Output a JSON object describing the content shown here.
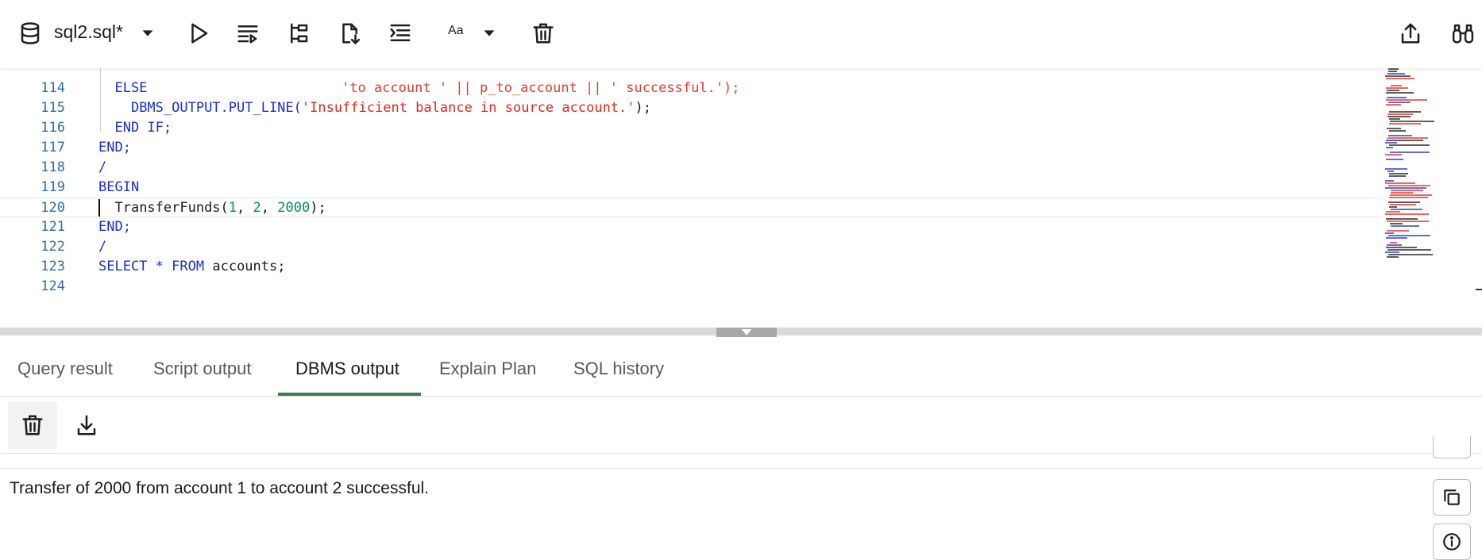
{
  "toolbar": {
    "file_name": "sql2.sql*",
    "font_label": "Aa",
    "icons": [
      "database-icon",
      "chevron-down-icon",
      "run-icon",
      "run-script-icon",
      "explain-plan-icon",
      "save-file-icon",
      "format-icon",
      "font-size-icon",
      "delete-icon",
      "share-icon",
      "binoculars-icon"
    ]
  },
  "editor": {
    "partial_top_line": "'to account ' || p_to_account || ' successful.');",
    "lines": [
      {
        "n": "114",
        "indent": "  ",
        "parts": [
          {
            "t": "ELSE",
            "c": "kw"
          }
        ]
      },
      {
        "n": "115",
        "indent": "    ",
        "parts": [
          {
            "t": "DBMS_OUTPUT.PUT_LINE(",
            "c": "kw"
          },
          {
            "t": "'Insufficient balance in source account.'",
            "c": "str"
          },
          {
            "t": ");",
            "c": "plain"
          }
        ]
      },
      {
        "n": "116",
        "indent": "  ",
        "parts": [
          {
            "t": "END IF;",
            "c": "kw"
          }
        ]
      },
      {
        "n": "117",
        "indent": "",
        "parts": [
          {
            "t": "END;",
            "c": "kw"
          }
        ]
      },
      {
        "n": "118",
        "indent": "",
        "parts": [
          {
            "t": "/",
            "c": "kw"
          }
        ]
      },
      {
        "n": "119",
        "indent": "",
        "parts": [
          {
            "t": "BEGIN",
            "c": "kw"
          }
        ]
      },
      {
        "n": "120",
        "indent": "  ",
        "parts": [
          {
            "t": "TransferFunds(",
            "c": "plain"
          },
          {
            "t": "1",
            "c": "num"
          },
          {
            "t": ", ",
            "c": "plain"
          },
          {
            "t": "2",
            "c": "num"
          },
          {
            "t": ", ",
            "c": "plain"
          },
          {
            "t": "2000",
            "c": "num"
          },
          {
            "t": ");",
            "c": "plain"
          }
        ]
      },
      {
        "n": "121",
        "indent": "",
        "parts": [
          {
            "t": "END;",
            "c": "kw"
          }
        ]
      },
      {
        "n": "122",
        "indent": "",
        "parts": [
          {
            "t": "/",
            "c": "kw"
          }
        ]
      },
      {
        "n": "123",
        "indent": "",
        "parts": [
          {
            "t": "SELECT",
            "c": "kw"
          },
          {
            "t": " ",
            "c": "plain"
          },
          {
            "t": "*",
            "c": "kw"
          },
          {
            "t": " ",
            "c": "plain"
          },
          {
            "t": "FROM",
            "c": "kw"
          },
          {
            "t": " accounts;",
            "c": "plain"
          }
        ]
      },
      {
        "n": "124",
        "indent": "",
        "parts": []
      }
    ]
  },
  "tabs": [
    {
      "label": "Query result",
      "active": false
    },
    {
      "label": "Script output",
      "active": false
    },
    {
      "label": "DBMS output",
      "active": true
    },
    {
      "label": "Explain Plan",
      "active": false
    },
    {
      "label": "SQL history",
      "active": false
    }
  ],
  "output": {
    "text": "Transfer of 2000 from account 1 to account 2 successful."
  },
  "colors": {
    "keyword": "#1a2fd6",
    "string": "#e1261c",
    "number": "#0b8a5a",
    "line_number": "#2b6ea8",
    "active_tab": "#3d7a50"
  }
}
